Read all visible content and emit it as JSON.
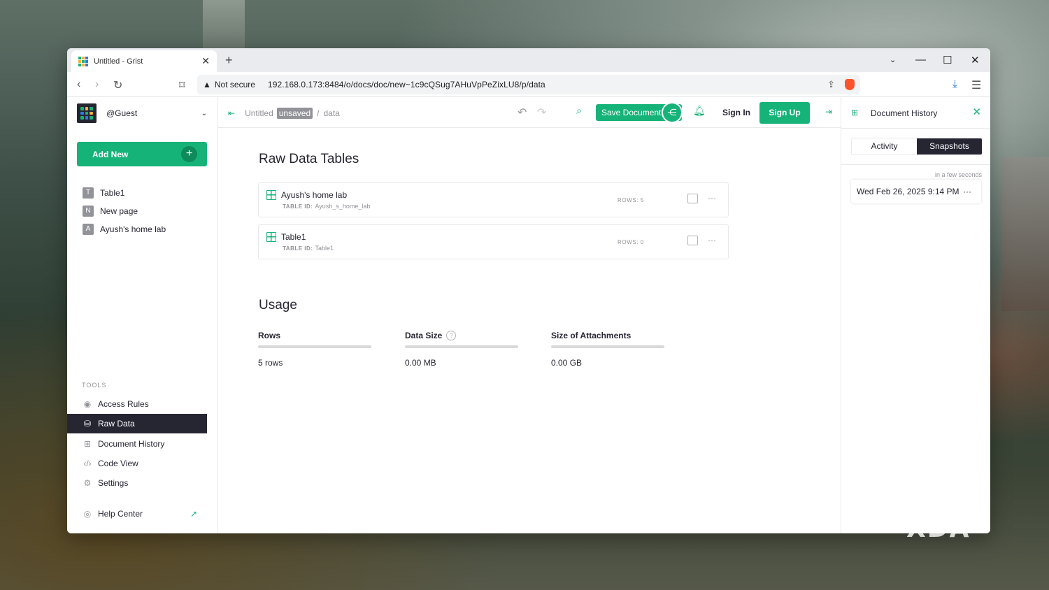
{
  "browser": {
    "tab_title": "Untitled - Grist",
    "security_label": "Not secure",
    "url": "192.168.0.173:8484/o/docs/doc/new~1c9cQSug7AHuVpPeZixLU8/p/data"
  },
  "sidebar": {
    "org_name": "@Guest",
    "add_new_label": "Add New",
    "pages": [
      {
        "initial": "T",
        "label": "Table1"
      },
      {
        "initial": "N",
        "label": "New page"
      },
      {
        "initial": "A",
        "label": "Ayush's home lab"
      }
    ],
    "tools_heading": "TOOLS",
    "tools": [
      {
        "icon": "eye-icon",
        "label": "Access Rules"
      },
      {
        "icon": "database-icon",
        "label": "Raw Data",
        "active": true
      },
      {
        "icon": "history-icon",
        "label": "Document History"
      },
      {
        "icon": "code-icon",
        "label": "Code View"
      },
      {
        "icon": "gear-icon",
        "label": "Settings"
      }
    ],
    "help_label": "Help Center"
  },
  "topbar": {
    "doc_name": "Untitled",
    "unsaved_badge": "unsaved",
    "page_name": "data",
    "save_label": "Save Document",
    "sign_in": "Sign In",
    "sign_up": "Sign Up"
  },
  "main": {
    "raw_title": "Raw Data Tables",
    "tables": [
      {
        "name": "Ayush's home lab",
        "id_label": "TABLE ID:",
        "id": "Ayush_s_home_lab",
        "rows": "ROWS: 5"
      },
      {
        "name": "Table1",
        "id_label": "TABLE ID:",
        "id": "Table1",
        "rows": "ROWS: 0"
      }
    ],
    "usage_title": "Usage",
    "usage": [
      {
        "label": "Rows",
        "value": "5 rows"
      },
      {
        "label": "Data Size",
        "value": "0.00 MB"
      },
      {
        "label": "Size of Attachments",
        "value": "0.00 GB"
      }
    ]
  },
  "right_panel": {
    "title": "Document History",
    "tabs": [
      "Activity",
      "Snapshots"
    ],
    "active_tab": "Snapshots",
    "relative_time": "in a few seconds",
    "snapshot_date": "Wed Feb 26, 2025 9:14 PM"
  },
  "watermark": "XDA",
  "colors": {
    "accent": "#16b378",
    "dark": "#262633",
    "muted": "#929299"
  }
}
